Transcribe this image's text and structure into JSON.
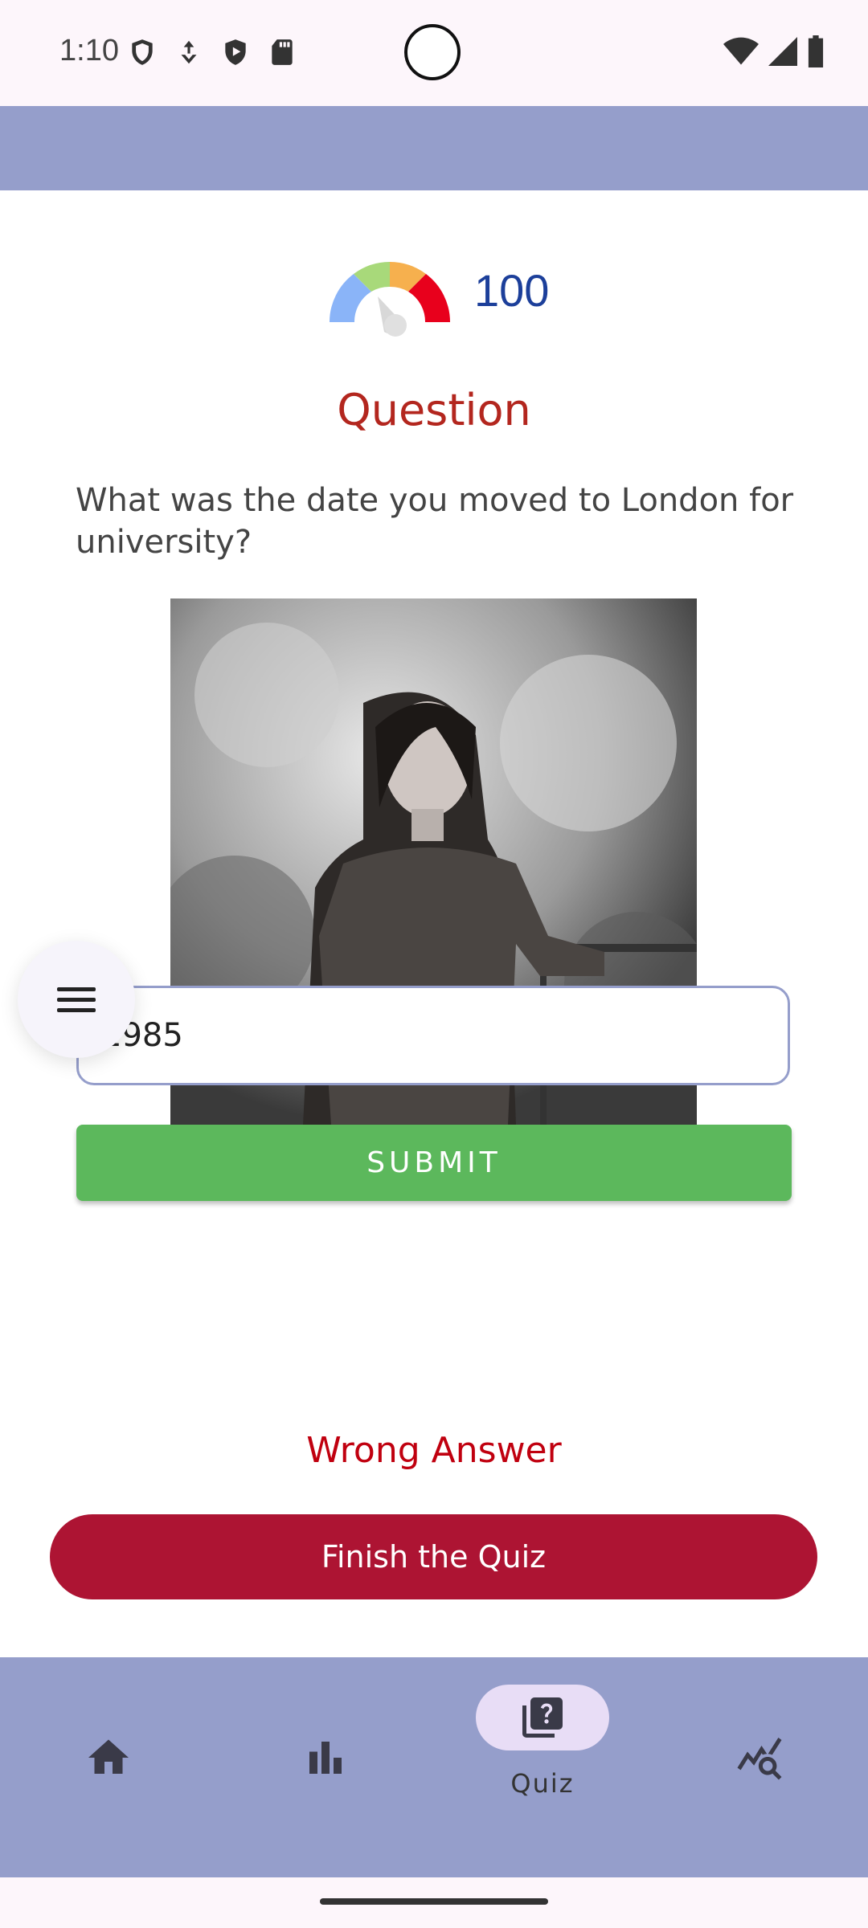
{
  "status_bar": {
    "time": "1:10",
    "left_icons": [
      "vpn-shield-icon",
      "download-icon",
      "play-protect-icon",
      "sd-card-icon"
    ],
    "right_icons": [
      "wifi-icon",
      "cell-signal-icon",
      "battery-icon"
    ]
  },
  "score": {
    "value": "100",
    "gauge_colors": [
      "#8ab4f8",
      "#a8d97a",
      "#f6b04e",
      "#e8001c"
    ]
  },
  "question": {
    "title": "Question",
    "text": "What was the date you moved to London for university?"
  },
  "photo": {
    "icon": "woman-portrait-photo"
  },
  "menu_fab": {
    "icon": "hamburger-menu-icon"
  },
  "answer": {
    "value": "1985",
    "placeholder": ""
  },
  "submit": {
    "label": "SUBMIT",
    "color": "#5cb85c"
  },
  "feedback": {
    "text": "Wrong Answer",
    "color": "#c0000f"
  },
  "finish": {
    "label": "Finish the Quiz",
    "color": "#ad1433"
  },
  "bottom_nav": {
    "items": [
      {
        "icon": "home-icon",
        "label": ""
      },
      {
        "icon": "bar-chart-icon",
        "label": ""
      },
      {
        "icon": "quiz-icon",
        "label": "Quiz",
        "active": true
      },
      {
        "icon": "insights-search-icon",
        "label": ""
      }
    ]
  },
  "colors": {
    "bar": "#959ecb",
    "score_text": "#1c3f9a",
    "title": "#b3261e"
  }
}
